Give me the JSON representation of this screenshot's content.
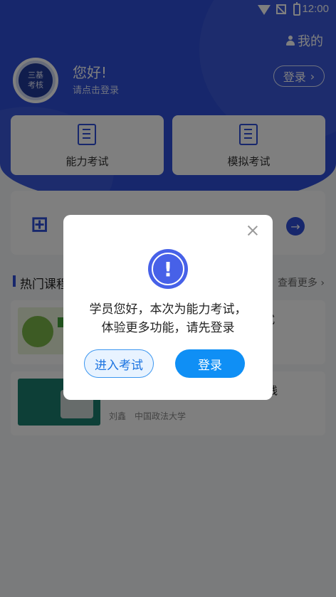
{
  "status_bar": {
    "time": "12:00"
  },
  "header": {
    "mine_label": "我的",
    "avatar_text_line1": "三基",
    "avatar_text_line2": "考核",
    "greeting": "您好!",
    "subtitle": "请点击登录",
    "login_button": "登录"
  },
  "quick_cards": [
    {
      "label": "能力考试",
      "icon": "exam-doc-icon"
    },
    {
      "label": "模拟考试",
      "icon": "mock-doc-icon"
    }
  ],
  "section": {
    "title": "热门课程",
    "more": "查看更多"
  },
  "courses": [
    {
      "title_visible": "式",
      "meta": ""
    },
    {
      "title_visible": "与实践",
      "meta": "刘鑫　中国政法大学"
    }
  ],
  "dialog": {
    "message_line1": "学员您好，本次为能力考试，",
    "message_line2": "体验更多功能，请先登录",
    "enter_button": "进入考试",
    "login_button": "登录"
  },
  "colors": {
    "primary": "#2f4fd8",
    "dialog_button": "#0f8ff5"
  }
}
